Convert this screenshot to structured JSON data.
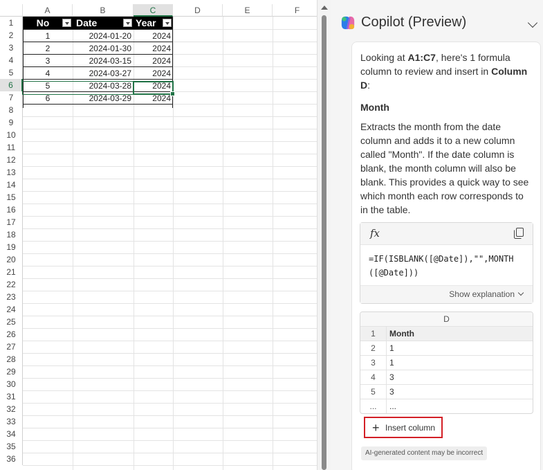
{
  "sheet": {
    "columns": [
      "A",
      "B",
      "C",
      "D",
      "E",
      "F"
    ],
    "rows": [
      "1",
      "2",
      "3",
      "4",
      "5",
      "6",
      "7",
      "8",
      "9",
      "10",
      "11",
      "12",
      "13",
      "14",
      "15",
      "16",
      "17",
      "18",
      "19",
      "20",
      "21",
      "22",
      "23",
      "24",
      "25",
      "26",
      "27",
      "28",
      "29",
      "30",
      "31",
      "32",
      "33",
      "34",
      "35",
      "36"
    ],
    "table_headers": [
      "No",
      "Date",
      "Year"
    ],
    "table_rows": [
      [
        "1",
        "2024-01-20",
        "2024"
      ],
      [
        "2",
        "2024-01-30",
        "2024"
      ],
      [
        "3",
        "2024-03-15",
        "2024"
      ],
      [
        "4",
        "2024-03-27",
        "2024"
      ],
      [
        "5",
        "2024-03-28",
        "2024"
      ],
      [
        "6",
        "2024-03-29",
        "2024"
      ]
    ],
    "selected_column": "C",
    "selected_row": "6"
  },
  "copilot": {
    "title": "Copilot (Preview)",
    "intro_prefix": "Looking at ",
    "intro_range": "A1:C7",
    "intro_middle": ", here's 1 formula column to review and insert in ",
    "intro_target": "Column D",
    "intro_suffix": ":",
    "column_name": "Month",
    "description": "Extracts the month from the date column and adds it to a new column called \"Month\". If the date column is blank, the month column will also be blank. This provides a quick way to see which month each row corresponds to in the table.",
    "fx_label": "fx",
    "formula": "=IF(ISBLANK([@Date]),\"\",MONTH([@Date]))",
    "show_explanation": "Show explanation",
    "preview": {
      "column_letter": "D",
      "rows": [
        {
          "num": "1",
          "value": "Month"
        },
        {
          "num": "2",
          "value": "1"
        },
        {
          "num": "3",
          "value": "1"
        },
        {
          "num": "4",
          "value": "3"
        },
        {
          "num": "5",
          "value": "3"
        },
        {
          "num": "...",
          "value": "..."
        }
      ]
    },
    "insert_label": "Insert column",
    "disclaimer": "AI-generated content may be incorrect"
  },
  "colors": {
    "excel_green": "#217346",
    "highlight_red": "#d31f26"
  }
}
